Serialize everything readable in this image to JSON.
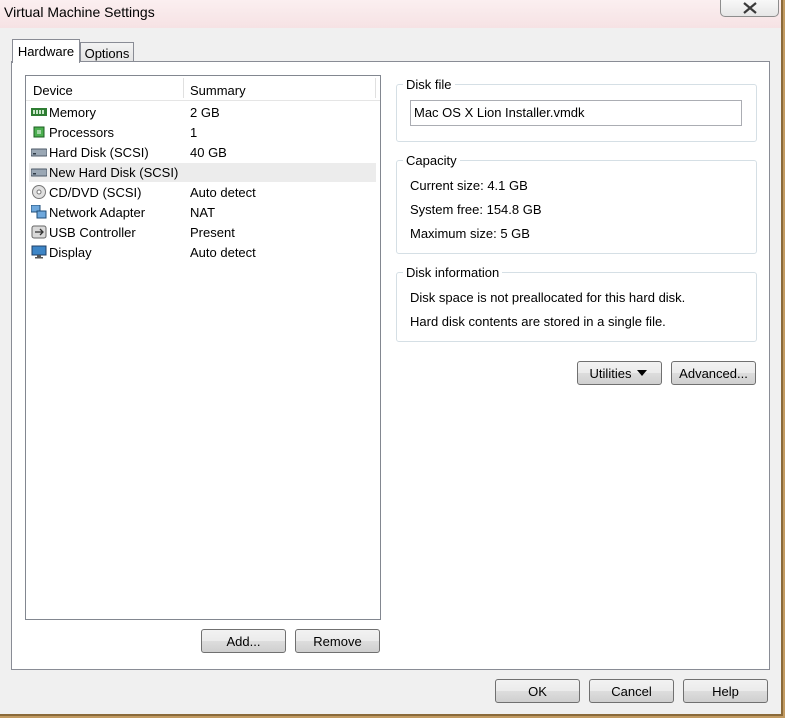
{
  "window": {
    "title": "Virtual Machine Settings"
  },
  "tabs": [
    {
      "label": "Hardware"
    },
    {
      "label": "Options"
    }
  ],
  "device_list": {
    "columns": [
      "Device",
      "Summary"
    ],
    "rows": [
      {
        "device": "Memory",
        "summary": "2 GB",
        "icon": "memory-icon"
      },
      {
        "device": "Processors",
        "summary": "1",
        "icon": "processor-icon"
      },
      {
        "device": "Hard Disk (SCSI)",
        "summary": "40 GB",
        "icon": "hard-disk-icon"
      },
      {
        "device": "New Hard Disk (SCSI)",
        "summary": "",
        "icon": "hard-disk-icon",
        "selected": true
      },
      {
        "device": "CD/DVD (SCSI)",
        "summary": "Auto detect",
        "icon": "cd-dvd-icon"
      },
      {
        "device": "Network Adapter",
        "summary": "NAT",
        "icon": "network-adapter-icon"
      },
      {
        "device": "USB Controller",
        "summary": "Present",
        "icon": "usb-icon"
      },
      {
        "device": "Display",
        "summary": "Auto detect",
        "icon": "display-icon"
      }
    ]
  },
  "list_buttons": {
    "add": "Add...",
    "remove": "Remove"
  },
  "disk_file": {
    "legend": "Disk file",
    "value": "Mac OS X Lion Installer.vmdk"
  },
  "capacity": {
    "legend": "Capacity",
    "current_label": "Current size:",
    "current_value": "4.1 GB",
    "free_label": "System free:",
    "free_value": "154.8 GB",
    "max_label": "Maximum size:",
    "max_value": "5 GB"
  },
  "disk_info": {
    "legend": "Disk information",
    "line1": "Disk space is not preallocated for this hard disk.",
    "line2": "Hard disk contents are stored in a single file."
  },
  "disk_buttons": {
    "utilities": "Utilities",
    "advanced": "Advanced..."
  },
  "dialog_buttons": {
    "ok": "OK",
    "cancel": "Cancel",
    "help": "Help"
  },
  "colors": {
    "selection": "#ececec",
    "panel": "#ffffff",
    "chrome": "#f0f0f0"
  }
}
